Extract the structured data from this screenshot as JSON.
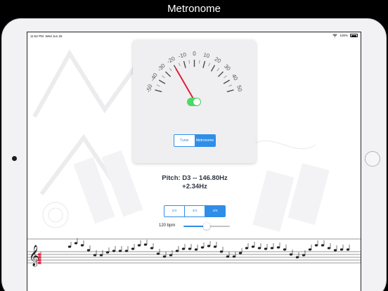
{
  "banner": {
    "title": "Metronome"
  },
  "status_bar": {
    "time": "11:52 PM",
    "date": "Wed Jun 26",
    "battery": "100%"
  },
  "tuner": {
    "scale_labels": [
      "-50",
      "-40",
      "-30",
      "-20",
      "-10",
      "0",
      "10",
      "20",
      "30",
      "40",
      "50"
    ],
    "needle_value": -20,
    "needle_color": "#e0203a",
    "toggle_on": true,
    "modes": [
      "Tuner",
      "Metronome"
    ],
    "active_mode": "Metronome"
  },
  "pitch": {
    "line1": "Pitch: D3 -- 146.80Hz",
    "line2": "+2.34Hz"
  },
  "time_signatures": {
    "options": [
      "2/4",
      "3/4",
      "4/4"
    ],
    "active": "4/4"
  },
  "tempo": {
    "label": "120 bpm",
    "value": 120,
    "slider_fraction": 0.5
  },
  "colors": {
    "accent": "#2f8ee8",
    "toggle_green": "#4cd964",
    "note_red": "#e0203a"
  }
}
